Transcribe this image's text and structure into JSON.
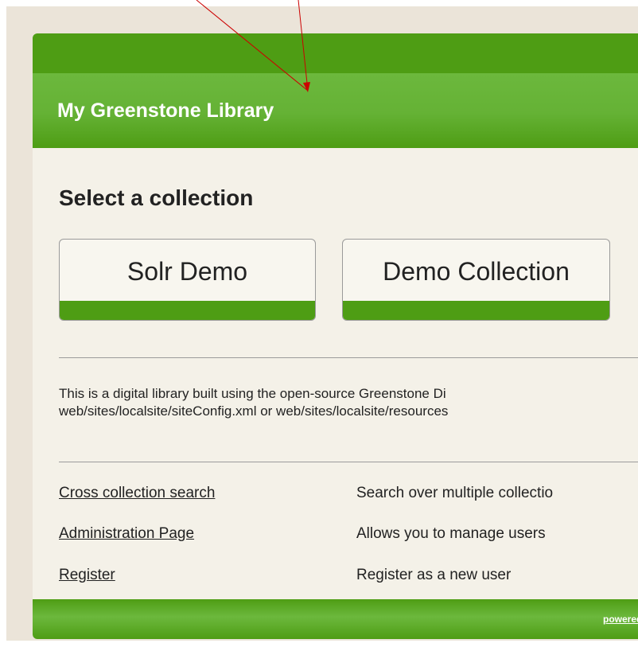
{
  "header": {
    "title": "My Greenstone Library"
  },
  "main": {
    "heading": "Select a collection",
    "collections": [
      {
        "label": "Solr Demo"
      },
      {
        "label": "Demo Collection"
      }
    ],
    "intro_lines": [
      "This is a digital library built using the open-source Greenstone Di",
      "web/sites/localsite/siteConfig.xml or web/sites/localsite/resources"
    ],
    "links": [
      {
        "label": "Cross collection search",
        "description": "Search over multiple collectio"
      },
      {
        "label": "Administration Page",
        "description": "Allows you to manage users"
      },
      {
        "label": "Register",
        "description": "Register as a new user"
      }
    ]
  },
  "footer": {
    "powered_text": "powered"
  },
  "colors": {
    "brand_green": "#4e9d14",
    "light_green": "#6cb83d",
    "page_background": "#f4f1e8",
    "outer_background": "#ebe4d9",
    "annotation_line": "#cc0000"
  }
}
